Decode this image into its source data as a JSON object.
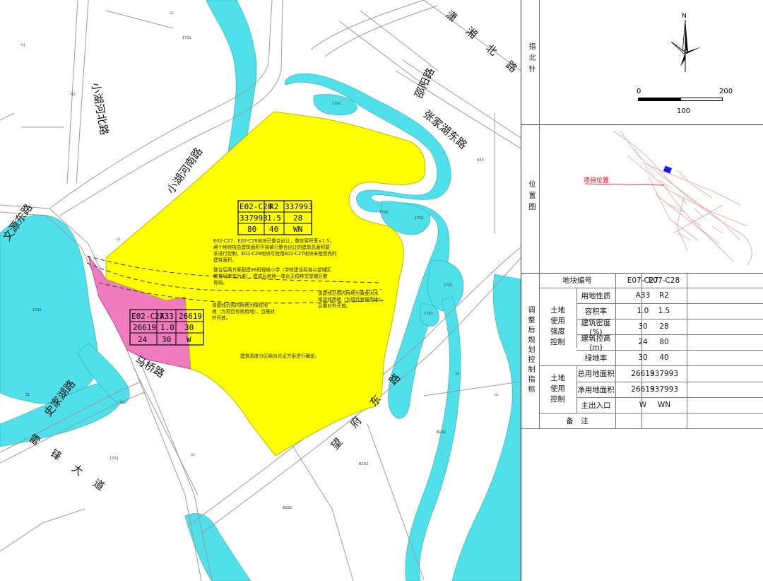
{
  "roads": {
    "xiaohu_north": "小湖河北路",
    "xiaohu_south": "小湖河南路",
    "wenyuan_east": "文源东路",
    "shijia_lake": "史家湖路",
    "maqiao": "马桥路",
    "leifeng": "雷锋大道",
    "wangfu_east": "望府东路",
    "xiaoxiang_north": "潇湘北路",
    "shaoyang": "邵阳路",
    "zhangjia_lake_east": "张家湖东路"
  },
  "parcel_c28": {
    "row1": [
      "E02-C28",
      "R2",
      "337993"
    ],
    "row2": [
      "337993",
      "1.5",
      "28"
    ],
    "row3": [
      "80",
      "40",
      "WN"
    ],
    "note_lines": [
      "E02-C27、E02-C28地块已整合出让，整体容积率≤1.5，",
      "两个地块按总建筑面积不突破已整合出让的建筑总面积要",
      "求进行控制，E02-C28地块可使用E02-C27地块未使用完的",
      "建筑面积。",
      "整合后两方案配建36班规格小学（学校建设标准以望城区",
      "教育局审定为准），建成后房地一体化无偿移交望城区教",
      "育局。"
    ]
  },
  "parcel_c27": {
    "row1": [
      "E02-C27",
      "A33",
      "26619"
    ],
    "row2": [
      "26619",
      "1.0",
      "30"
    ],
    "row3": [
      "24",
      "30",
      "W"
    ]
  },
  "annotations": {
    "green_note_1": "该虚线范围内用地为绿化用",
    "green_note_2": "地（为项目有效用地），且需对",
    "green_note_3": "外开放。",
    "yellow_note_1": "该虚线范围内用地为黄金河水",
    "yellow_note_2": "域蓝线用地（为项目有效用地），",
    "yellow_note_3": "且需对外开放。",
    "height_note": "建筑高度分区结合论证方案进行确定。"
  },
  "map_codes": {
    "g1": "G1",
    "r2": "R2",
    "b1b2": "B1B2",
    "b1r2": "B1R2",
    "s1": "S1",
    "a33": "A33",
    "u1_1": "1701",
    "u1_2": "1701",
    "u1_3": "1701",
    "u1_4": "1701",
    "u1_5": "1701",
    "u1_6": "1701",
    "u1_7": "1701",
    "u1_8": "1701"
  },
  "sidebar": {
    "north_label": "指北针",
    "north_letter": "N",
    "scale_0": "0",
    "scale_100": "100",
    "scale_200": "200",
    "location_label": "位置图",
    "project_location": "项目位置",
    "adjust_label": "调整后规划控制指标",
    "table": {
      "header": [
        "地块编号",
        "E07-C27",
        "E07-C28"
      ],
      "group1": "土地使用强度控制",
      "group2": "土地使用控制",
      "rows": [
        {
          "name": "用地性质",
          "a": "A33",
          "b": "R2"
        },
        {
          "name": "容积率",
          "a": "1.0",
          "b": "1.5"
        },
        {
          "name": "建筑密度(%)",
          "a": "30",
          "b": "28"
        },
        {
          "name": "建筑控高(m)",
          "a": "24",
          "b": "80"
        },
        {
          "name": "绿地率",
          "a": "30",
          "b": "40"
        },
        {
          "name": "总用地面积",
          "a": "26619",
          "b": "337993"
        },
        {
          "name": "净用地面积",
          "a": "26619",
          "b": "337993"
        },
        {
          "name": "主出入口",
          "a": "W",
          "b": "WN"
        },
        {
          "name": "备　注",
          "a": "",
          "b": ""
        }
      ]
    }
  },
  "colors": {
    "water": "#4fe0ea",
    "residential": "#ffff00",
    "education": "#f07cc0",
    "road_line": "#9a9a9a"
  }
}
